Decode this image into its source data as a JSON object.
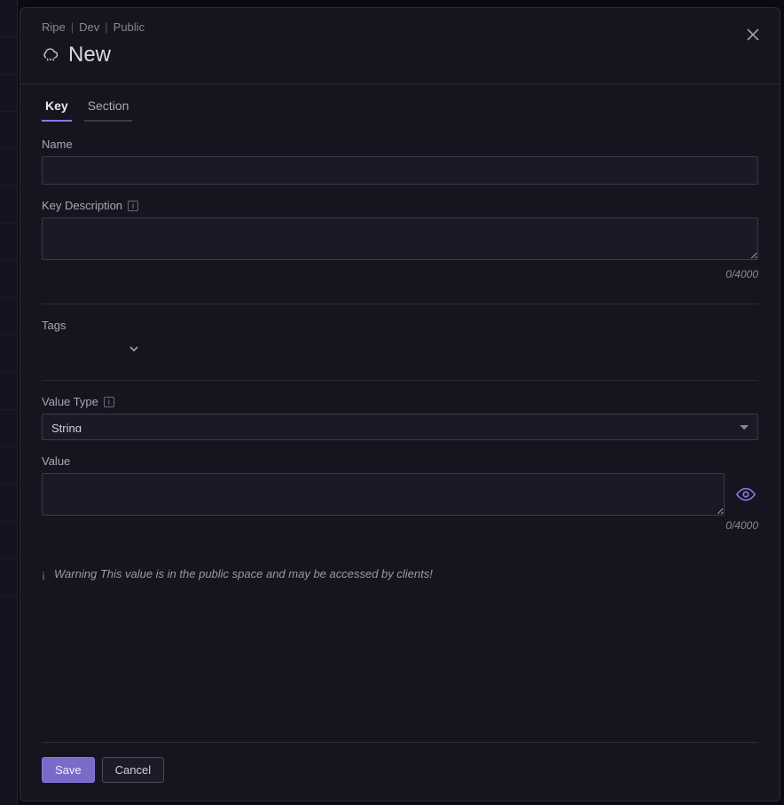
{
  "breadcrumb": [
    "Ripe",
    "Dev",
    "Public"
  ],
  "title": "New",
  "tabs": [
    {
      "label": "Key",
      "active": true
    },
    {
      "label": "Section",
      "active": false
    }
  ],
  "fields": {
    "name": {
      "label": "Name",
      "value": ""
    },
    "description": {
      "label": "Key Description",
      "value": "",
      "counter": "0/4000",
      "maxlength": 4000
    },
    "tags": {
      "label": "Tags",
      "value": ""
    },
    "valueType": {
      "label": "Value Type",
      "selected": "String",
      "options": [
        "String"
      ]
    },
    "value": {
      "label": "Value",
      "value": "",
      "counter": "0/4000",
      "maxlength": 4000
    }
  },
  "warning": {
    "label": "Warning",
    "text": "This value is in the public space and may be accessed by clients!"
  },
  "buttons": {
    "save": "Save",
    "cancel": "Cancel"
  }
}
